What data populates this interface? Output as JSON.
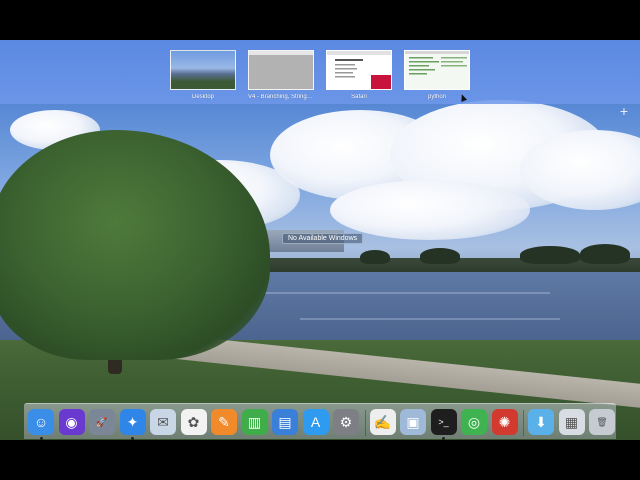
{
  "mission_control": {
    "spaces": [
      {
        "label": "Desktop"
      },
      {
        "label": "V4 - Branching, Strings..."
      },
      {
        "label": "Safari"
      },
      {
        "label": "python"
      }
    ],
    "add_space_glyph": "+"
  },
  "desktop": {
    "no_windows_text": "No Available Windows"
  },
  "dock": {
    "apps": [
      {
        "name": "finder-icon",
        "glyph": "☺",
        "color": "#3b8ee8"
      },
      {
        "name": "siri-icon",
        "glyph": "◉",
        "color": "#6a3ad0"
      },
      {
        "name": "launchpad-icon",
        "glyph": "🚀",
        "color": "#7b8796"
      },
      {
        "name": "safari-icon",
        "glyph": "✦",
        "color": "#2f86e8"
      },
      {
        "name": "mail-stamp-icon",
        "glyph": "✉",
        "color": "#c9d6e6"
      },
      {
        "name": "photos-icon",
        "glyph": "✿",
        "color": "#f2f2f2"
      },
      {
        "name": "pages-icon",
        "glyph": "✎",
        "color": "#f08a2a"
      },
      {
        "name": "numbers-icon",
        "glyph": "▥",
        "color": "#3fae4a"
      },
      {
        "name": "keynote-icon",
        "glyph": "▤",
        "color": "#3a7fd8"
      },
      {
        "name": "app-store-icon",
        "glyph": "A",
        "color": "#2f9bf0"
      },
      {
        "name": "system-preferences-icon",
        "glyph": "⚙",
        "color": "#7d7f85"
      },
      {
        "name": "textedit-icon",
        "glyph": "✍",
        "color": "#eeeeee"
      },
      {
        "name": "preview-icon",
        "glyph": "▣",
        "color": "#9fb9d8"
      },
      {
        "name": "terminal-icon",
        "glyph": ">_",
        "color": "#1e1e1e"
      },
      {
        "name": "activity-monitor-icon",
        "glyph": "◎",
        "color": "#3fb34f"
      },
      {
        "name": "spider-icon",
        "glyph": "✺",
        "color": "#d23a2f"
      },
      {
        "name": "downloads-folder-icon",
        "glyph": "⬇",
        "color": "#5ab1ea"
      },
      {
        "name": "documents-stack-icon",
        "glyph": "▦",
        "color": "#d8dde4"
      },
      {
        "name": "trash-icon",
        "glyph": "🗑",
        "color": "#c6cbd2"
      }
    ]
  }
}
